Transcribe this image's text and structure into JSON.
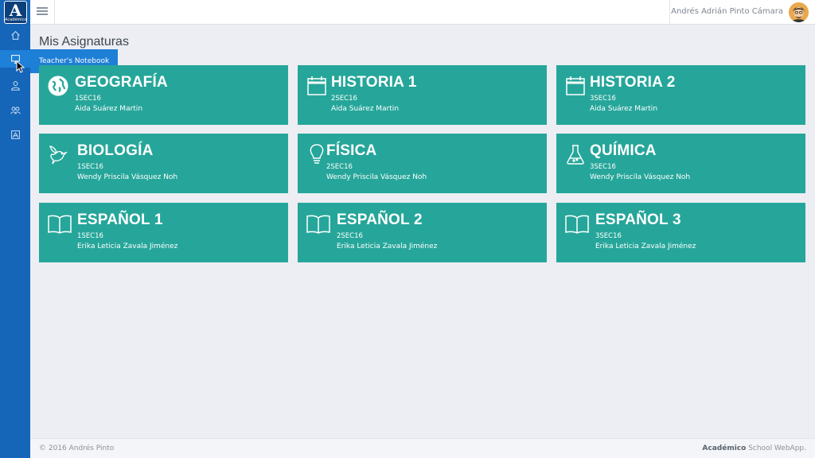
{
  "app": {
    "logo_letter": "A",
    "logo_sub": "Académico"
  },
  "sidebar": {
    "items": [
      {
        "name": "home",
        "icon": "home-icon"
      },
      {
        "name": "notebook",
        "icon": "monitor-icon",
        "active": true
      },
      {
        "name": "profile",
        "icon": "user-icon"
      },
      {
        "name": "groups",
        "icon": "users-icon"
      },
      {
        "name": "school",
        "icon": "school-icon"
      }
    ],
    "tooltip": "Teacher's Notebook"
  },
  "header": {
    "user_name": "Andrés Adrián Pinto Cámara"
  },
  "main": {
    "title": "Mis Asignaturas",
    "subjects": [
      {
        "title": "GEOGRAFÍA",
        "code": "1SEC16",
        "teacher": "Aida Suárez Martin",
        "icon": "globe-icon"
      },
      {
        "title": "HISTORIA 1",
        "code": "2SEC16",
        "teacher": "Aida Suárez Martin",
        "icon": "calendar-icon"
      },
      {
        "title": "HISTORIA 2",
        "code": "3SEC16",
        "teacher": "Aida Suárez Martin",
        "icon": "calendar-icon"
      },
      {
        "title": "BIOLOGÍA",
        "code": "1SEC16",
        "teacher": "Wendy Priscila Vásquez Noh",
        "icon": "bird-icon"
      },
      {
        "title": "FÍSICA",
        "code": "2SEC16",
        "teacher": "Wendy Priscila Vásquez Noh",
        "icon": "lightbulb-icon"
      },
      {
        "title": "QUÍMICA",
        "code": "3SEC16",
        "teacher": "Wendy Priscila Vásquez Noh",
        "icon": "flask-icon"
      },
      {
        "title": "ESPAÑOL 1",
        "code": "1SEC16",
        "teacher": "Erika Leticia Zavala Jiménez",
        "icon": "book-icon"
      },
      {
        "title": "ESPAÑOL 2",
        "code": "2SEC16",
        "teacher": "Erika Leticia Zavala Jiménez",
        "icon": "book-icon"
      },
      {
        "title": "ESPAÑOL 3",
        "code": "3SEC16",
        "teacher": "Erika Leticia Zavala Jiménez",
        "icon": "book-icon"
      }
    ]
  },
  "footer": {
    "copyright": "© 2016 Andrés Pinto",
    "brand": "Académico",
    "brand_suffix": " School WebApp."
  },
  "colors": {
    "sidebar": "#1565b8",
    "card": "#26a69a",
    "background": "#eceef3"
  }
}
